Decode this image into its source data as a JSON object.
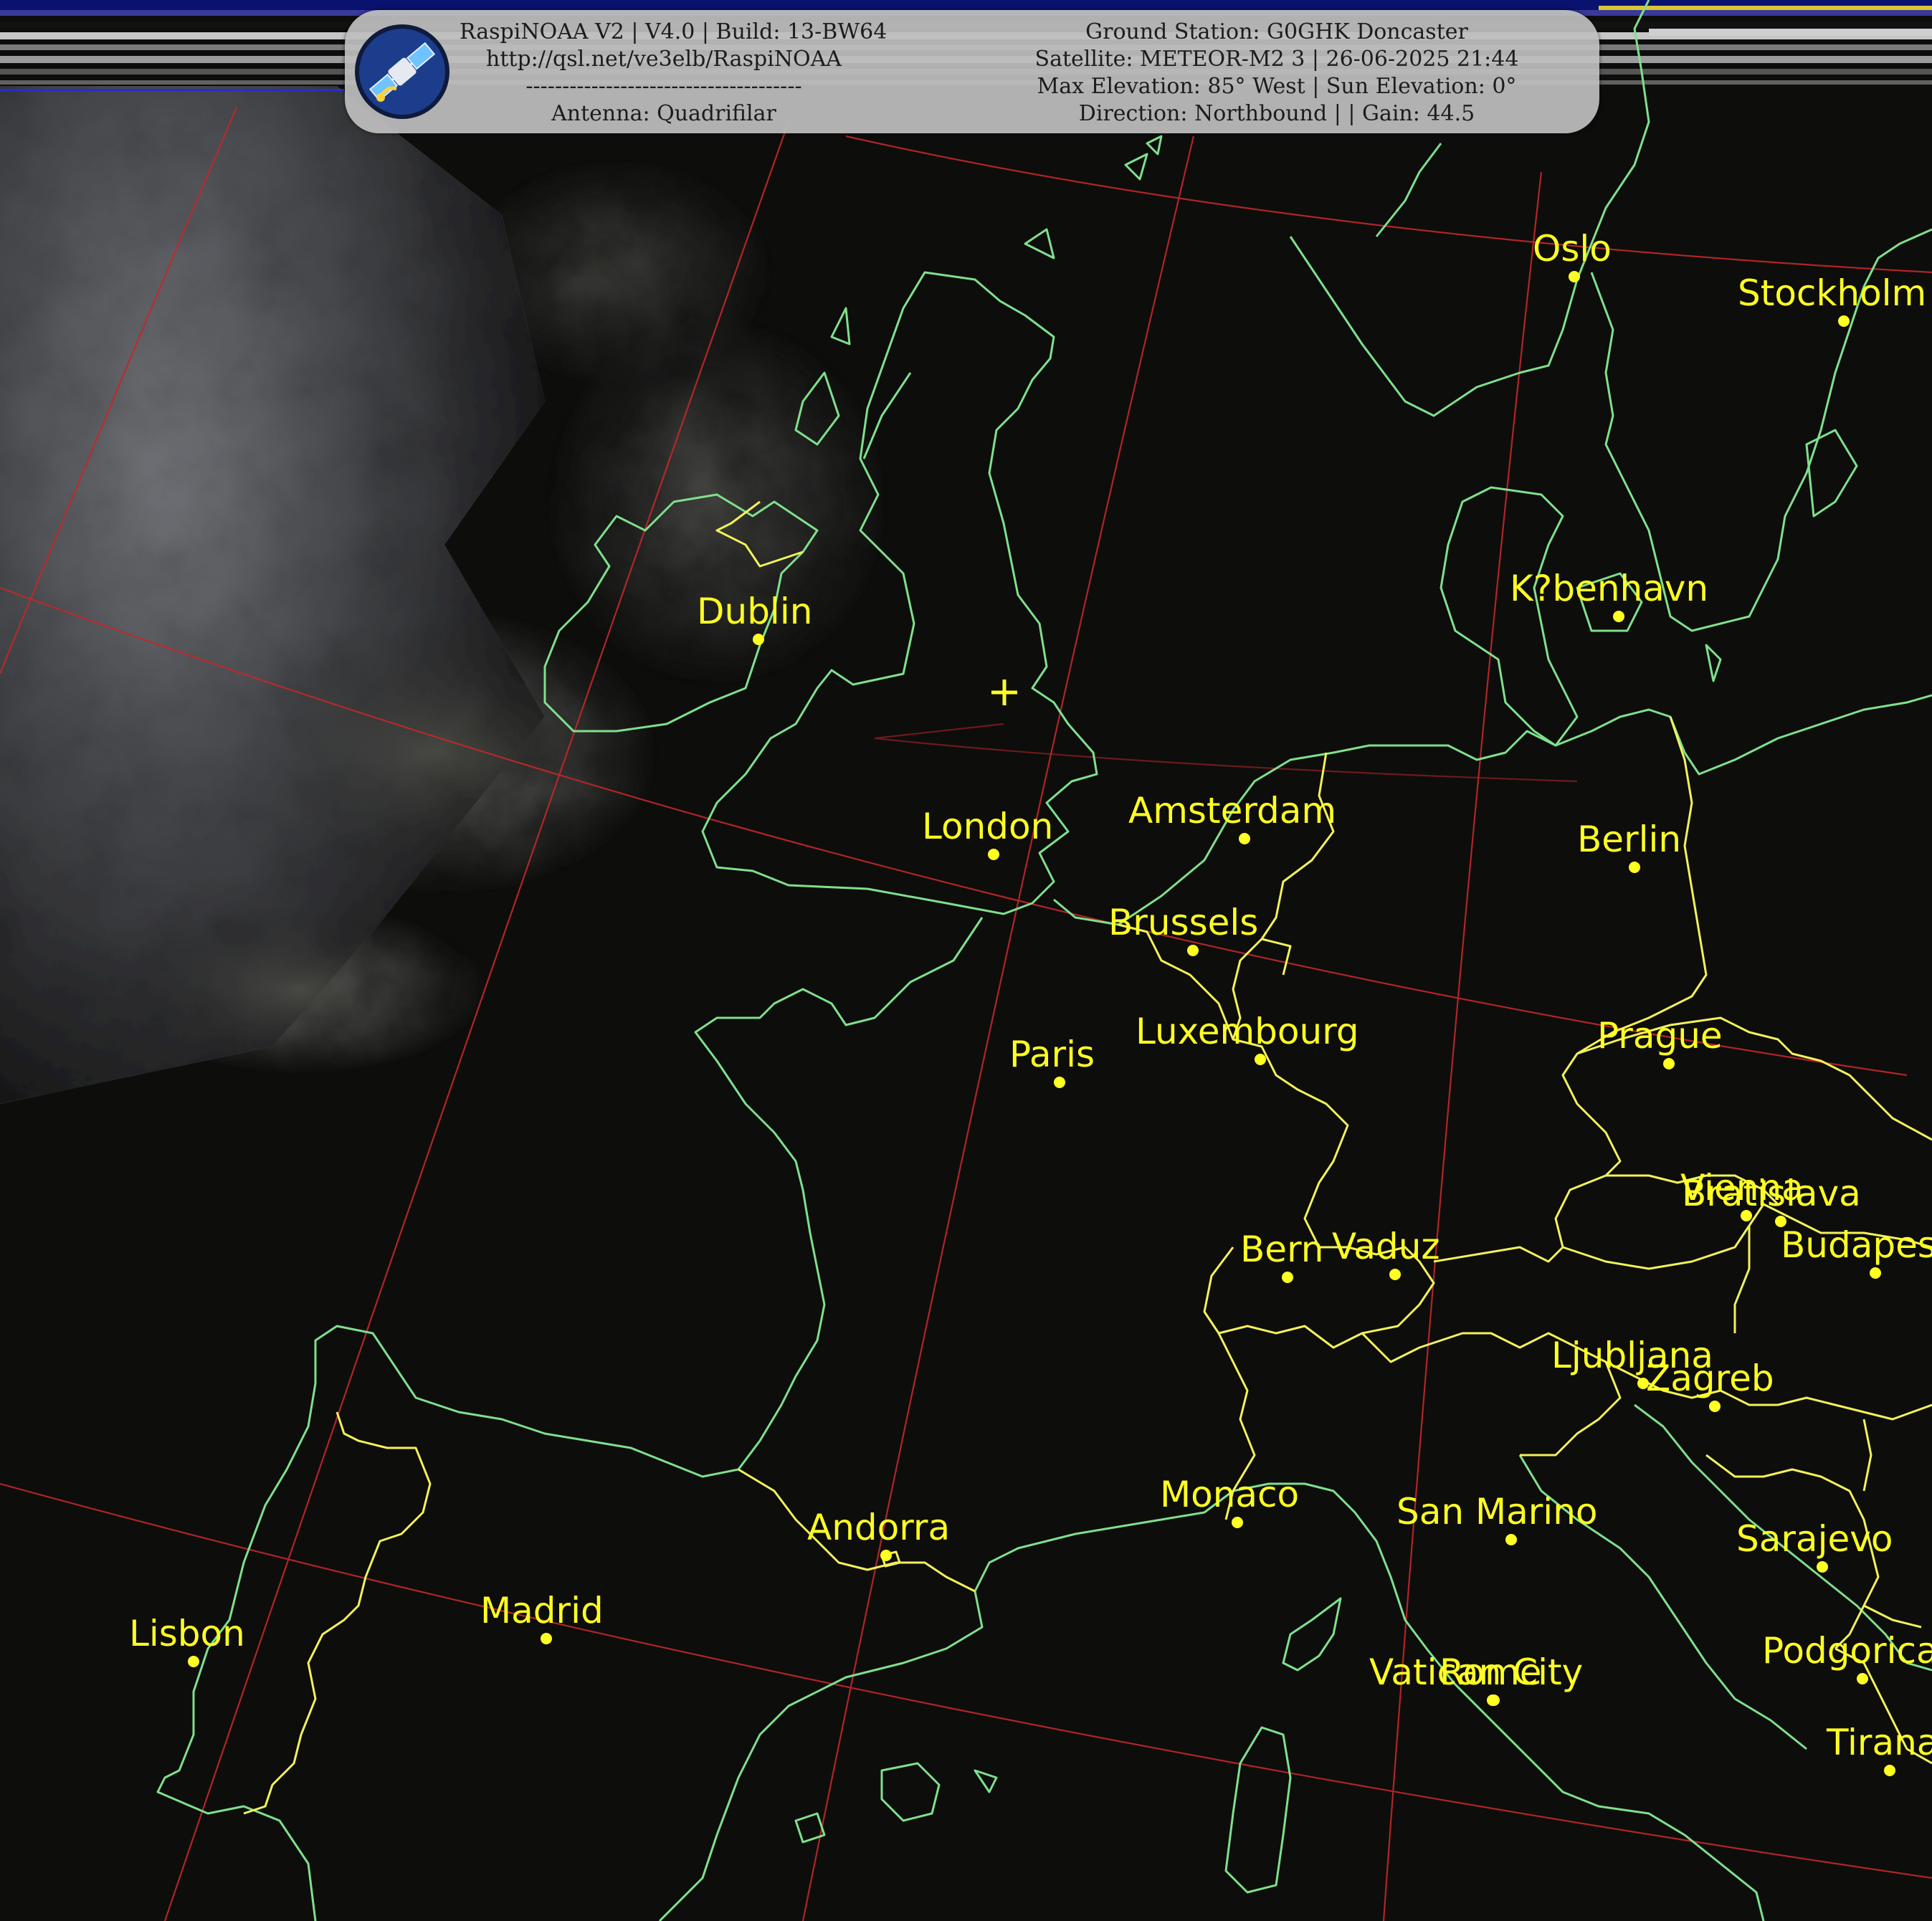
{
  "header": {
    "left": {
      "software": "RaspiNOAA V2 | V4.0 | Build: 13-BW64",
      "url": "http://qsl.net/ve3elb/RaspiNOAA",
      "divider": "--------------------------------------",
      "antenna": "Antenna: Quadrifilar"
    },
    "right": {
      "ground_station": "Ground Station: G0GHK Doncaster",
      "satellite": "Satellite: METEOR-M2 3 | 26-06-2025 21:44",
      "elevation": "Max Elevation: 85° West | Sun Elevation: 0°",
      "direction": "Direction: Northbound | | Gain: 44.5"
    }
  },
  "logo_icon": "satellite-icon",
  "colors": {
    "coastline": "#7fe08c",
    "border": "#f2f25a",
    "grid": "#c2282a",
    "label": "#ffff22"
  },
  "cities": [
    {
      "name": "Oslo"
    },
    {
      "name": "Stockholm"
    },
    {
      "name": "Dublin"
    },
    {
      "name": "K?benhavn"
    },
    {
      "name": "London"
    },
    {
      "name": "Amsterdam"
    },
    {
      "name": "Berlin"
    },
    {
      "name": "Brussels"
    },
    {
      "name": "Luxembourg"
    },
    {
      "name": "Paris"
    },
    {
      "name": "Prague"
    },
    {
      "name": "Vienna"
    },
    {
      "name": "Bratislava"
    },
    {
      "name": "Budapest"
    },
    {
      "name": "Bern"
    },
    {
      "name": "Vaduz"
    },
    {
      "name": "Ljubljana"
    },
    {
      "name": "Zagreb"
    },
    {
      "name": "Monaco"
    },
    {
      "name": "San Marino"
    },
    {
      "name": "Andorra"
    },
    {
      "name": "Sarajevo"
    },
    {
      "name": "Madrid"
    },
    {
      "name": "Lisbon"
    },
    {
      "name": "Vatican City"
    },
    {
      "name": "Rome"
    },
    {
      "name": "Podgorica"
    },
    {
      "name": "Tirana"
    }
  ]
}
